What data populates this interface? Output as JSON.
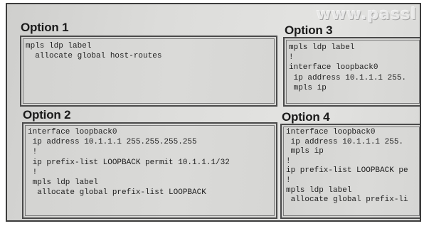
{
  "watermark": "www.passl",
  "options": [
    {
      "title": "Option 1",
      "lines": [
        "mpls ldp label",
        "  allocate global host-routes"
      ]
    },
    {
      "title": "Option 2",
      "lines": [
        "interface loopback0",
        " ip address 10.1.1.1 255.255.255.255",
        " !",
        " ip prefix-list LOOPBACK permit 10.1.1.1/32",
        " !",
        " mpls ldp label",
        "  allocate global prefix-list LOOPBACK"
      ]
    },
    {
      "title": "Option 3",
      "lines": [
        "mpls ldp label",
        "!",
        "interface loopback0",
        " ip address 10.1.1.1 255.",
        " mpls ip"
      ]
    },
    {
      "title": "Option 4",
      "lines": [
        "interface loopback0",
        " ip address 10.1.1.1 255.",
        " mpls ip",
        "!",
        "ip prefix-list LOOPBACK pe",
        "!",
        "mpls ldp label",
        " allocate global prefix-li"
      ]
    }
  ]
}
